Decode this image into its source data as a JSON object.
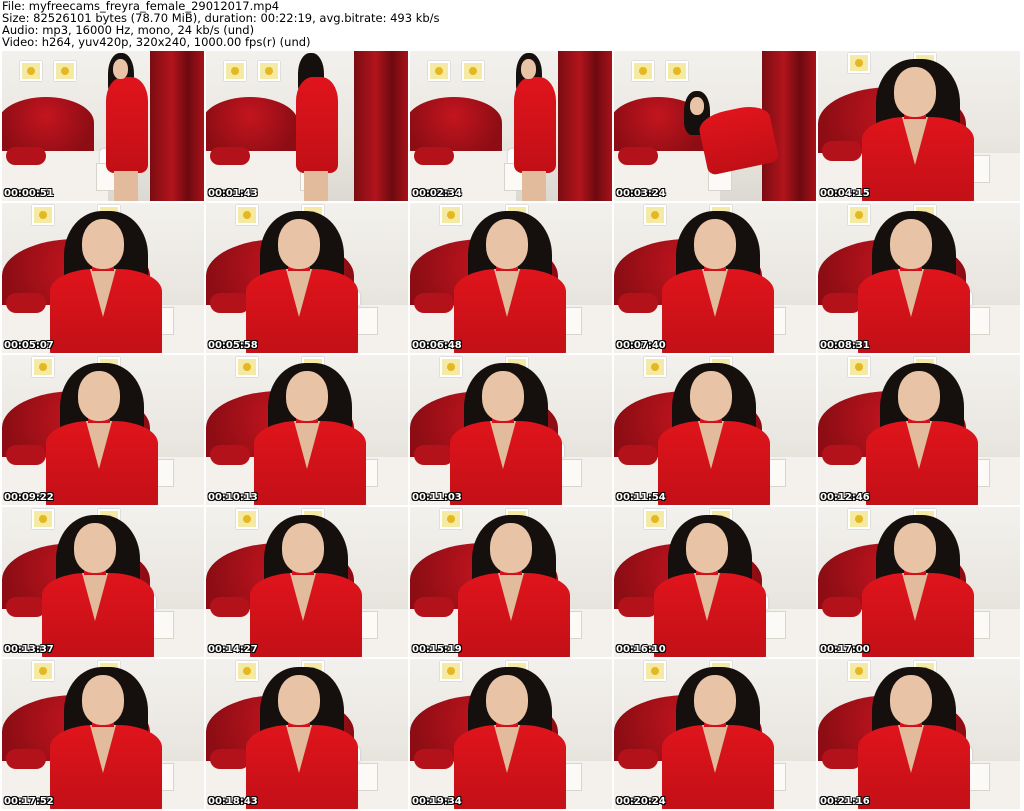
{
  "header": {
    "file": "File: myfreecams_freyra_female_29012017.mp4",
    "size": "Size: 82526101 bytes (78.70 MiB), duration: 00:22:19, avg.bitrate: 493 kb/s",
    "audio": "Audio: mp3, 16000 Hz, mono, 24 kb/s (und)",
    "video": "Video: h264, yuv420p, 320x240, 1000.00 fps(r) (und)"
  },
  "thumbnails": [
    {
      "time": "00:00:51",
      "pose": "standing-far"
    },
    {
      "time": "00:01:43",
      "pose": "standing-back"
    },
    {
      "time": "00:02:34",
      "pose": "standing-far"
    },
    {
      "time": "00:03:24",
      "pose": "leaning"
    },
    {
      "time": "00:04:15",
      "pose": "close"
    },
    {
      "time": "00:05:07",
      "pose": "close"
    },
    {
      "time": "00:05:58",
      "pose": "close"
    },
    {
      "time": "00:06:48",
      "pose": "close"
    },
    {
      "time": "00:07:40",
      "pose": "close"
    },
    {
      "time": "00:08:31",
      "pose": "close"
    },
    {
      "time": "00:09:22",
      "pose": "close"
    },
    {
      "time": "00:10:13",
      "pose": "close"
    },
    {
      "time": "00:11:03",
      "pose": "close"
    },
    {
      "time": "00:11:54",
      "pose": "close"
    },
    {
      "time": "00:12:46",
      "pose": "close"
    },
    {
      "time": "00:13:37",
      "pose": "close"
    },
    {
      "time": "00:14:27",
      "pose": "close"
    },
    {
      "time": "00:15:19",
      "pose": "close"
    },
    {
      "time": "00:16:10",
      "pose": "close"
    },
    {
      "time": "00:17:00",
      "pose": "close"
    },
    {
      "time": "00:17:52",
      "pose": "close"
    },
    {
      "time": "00:18:43",
      "pose": "close"
    },
    {
      "time": "00:19:34",
      "pose": "close"
    },
    {
      "time": "00:20:24",
      "pose": "close"
    },
    {
      "time": "00:21:16",
      "pose": "close"
    }
  ],
  "colors": {
    "dress": "#d4121a",
    "headboard": "#a8101a",
    "wall": "#ece9e4",
    "timestamp_text": "#ffffff"
  }
}
